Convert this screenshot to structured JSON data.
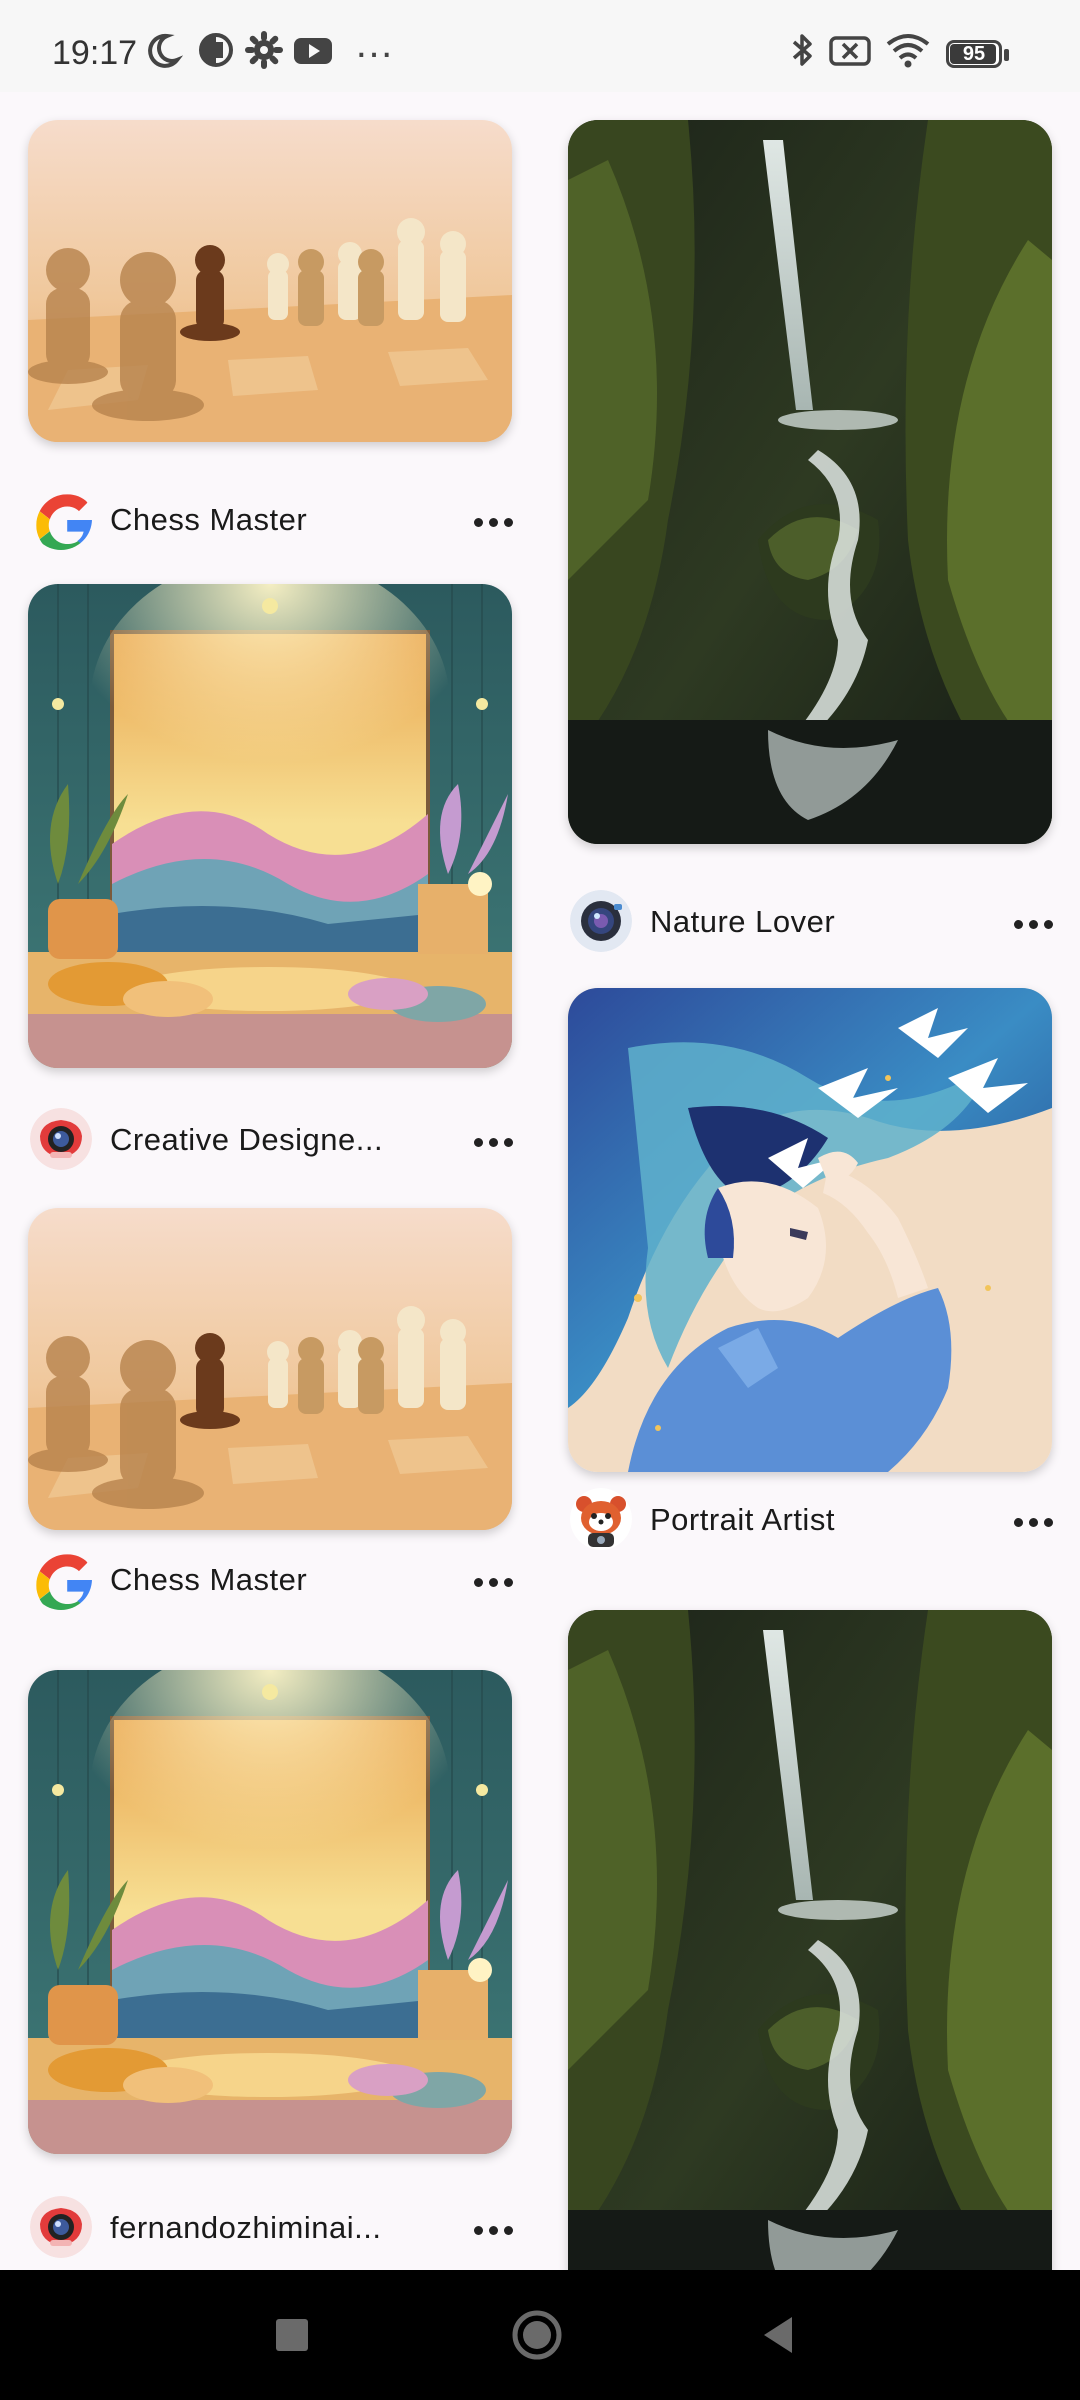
{
  "status_bar": {
    "time": "19:17",
    "more": "…",
    "battery_level": "95",
    "icons": [
      "moon-icon",
      "data-saver-icon",
      "settings-gear-icon",
      "youtube-icon",
      "bluetooth-icon",
      "no-sim-icon",
      "wifi-icon",
      "battery-icon"
    ]
  },
  "feed": {
    "left_column": [
      {
        "author": "Chess Master",
        "avatar": "google-logo",
        "image": "chess-pieces-image"
      },
      {
        "author": "Creative Designe...",
        "avatar": "camera-avatar",
        "image": "interior-mural-image"
      },
      {
        "author": "Chess Master",
        "avatar": "google-logo",
        "image": "chess-pieces-image"
      },
      {
        "author": "fernandozhiminai...",
        "avatar": "camera-avatar",
        "image": "interior-mural-image"
      }
    ],
    "right_column": [
      {
        "author": "Nature Lover",
        "avatar": "lens-avatar",
        "image": "waterfall-image"
      },
      {
        "author": "Portrait Artist",
        "avatar": "red-panda-avatar",
        "image": "anime-portrait-image"
      },
      {
        "author": "",
        "avatar": "",
        "image": "waterfall-image"
      }
    ]
  },
  "nav_bar": {
    "buttons": [
      "recents-square-icon",
      "home-circle-icon",
      "back-triangle-icon"
    ]
  },
  "colors": {
    "status_bg": "#f7f7f7",
    "feed_bg": "#fbf8fb",
    "nav_bg": "#000000",
    "text": "#1a1a1a"
  }
}
